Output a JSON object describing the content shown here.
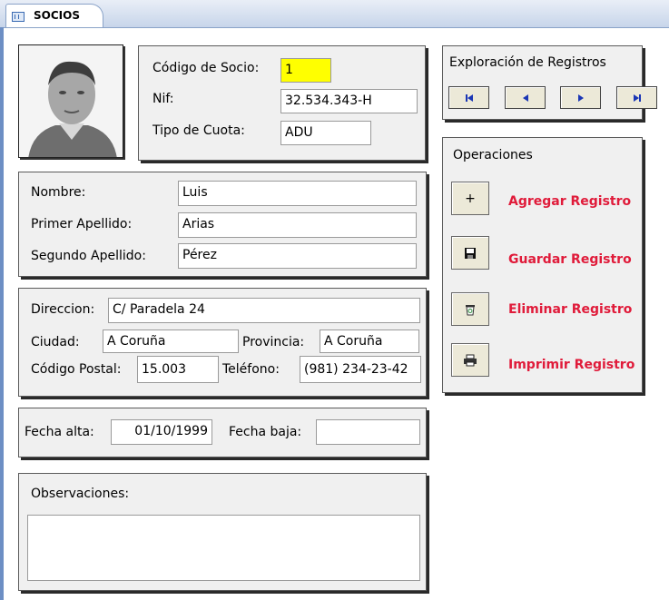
{
  "tab": {
    "title": "SOCIOS"
  },
  "socio": {
    "codigo_label": "Código de Socio:",
    "codigo_value": "1",
    "nif_label": "Nif:",
    "nif_value": "32.534.343-H",
    "cuota_label": "Tipo de Cuota:",
    "cuota_value": "ADU"
  },
  "persona": {
    "nombre_label": "Nombre:",
    "nombre_value": "Luis",
    "apellido1_label": "Primer Apellido:",
    "apellido1_value": "Arias",
    "apellido2_label": "Segundo Apellido:",
    "apellido2_value": "Pérez"
  },
  "direccion": {
    "direccion_label": "Direccion:",
    "direccion_value": "C/ Paradela 24",
    "ciudad_label": "Ciudad:",
    "ciudad_value": "A Coruña",
    "provincia_label": "Provincia:",
    "provincia_value": "A Coruña",
    "cp_label": "Código Postal:",
    "cp_value": "15.003",
    "telefono_label": "Teléfono:",
    "telefono_value": "(981) 234-23-42"
  },
  "fechas": {
    "alta_label": "Fecha alta:",
    "alta_value": "01/10/1999",
    "baja_label": "Fecha baja:",
    "baja_value": ""
  },
  "observaciones": {
    "label": "Observaciones:",
    "value": ""
  },
  "exploracion": {
    "title": "Exploración de Registros",
    "first_icon": "first-record-icon",
    "prev_icon": "prev-record-icon",
    "next_icon": "next-record-icon",
    "last_icon": "last-record-icon"
  },
  "operaciones": {
    "title": "Operaciones",
    "add_label": "Agregar Registro",
    "add_glyph": "+",
    "save_label": "Guardar Registro",
    "delete_label": "Eliminar Registro",
    "print_label": "Imprimir Registro"
  },
  "colors": {
    "accent": "#e01b3a",
    "highlight": "#ffff00",
    "nav_arrow": "#1a36b5"
  }
}
